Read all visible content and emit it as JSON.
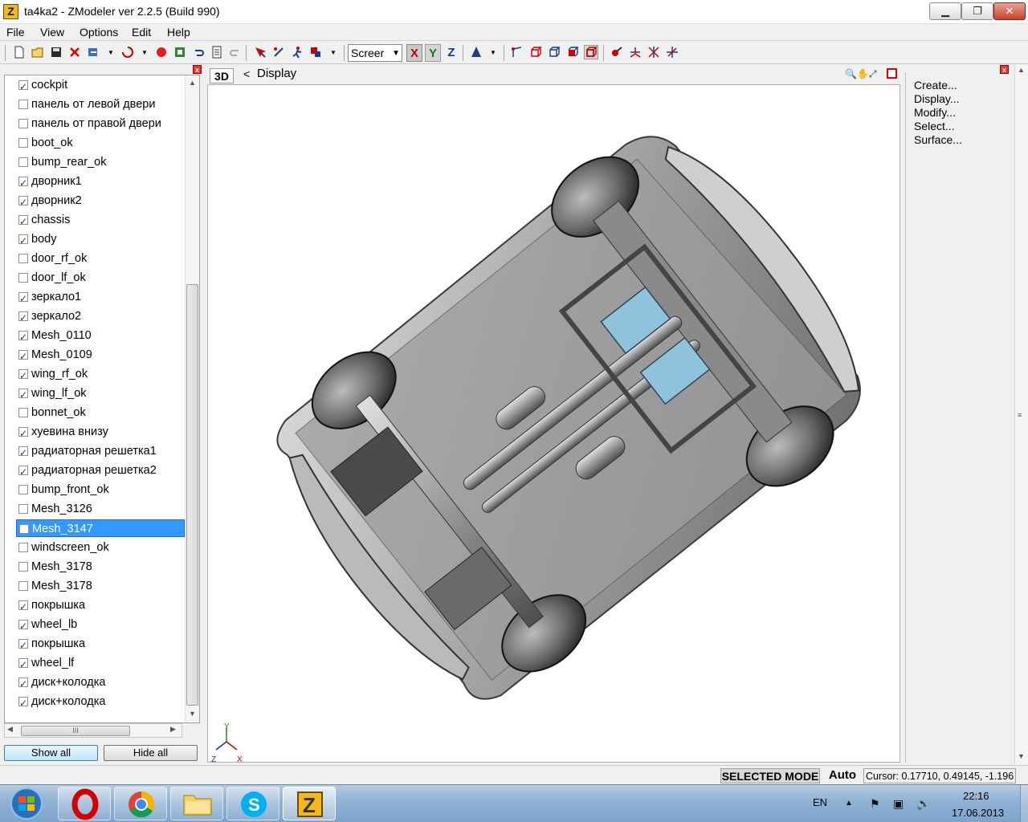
{
  "window": {
    "title": "ta4ka2 - ZModeler ver 2.2.5 (Build 990)",
    "app_icon_letter": "Z",
    "min_glyph": "▁",
    "max_glyph": "❐",
    "close_glyph": "✕"
  },
  "menu": [
    "File",
    "View",
    "Options",
    "Edit",
    "Help"
  ],
  "toolbar": {
    "view_select": "Screer",
    "axis": [
      "X",
      "Y",
      "Z"
    ]
  },
  "left_panel": {
    "close_glyph": "x",
    "objects": [
      {
        "name": "cockpit",
        "checked": true
      },
      {
        "name": "панель от левой двери",
        "checked": false
      },
      {
        "name": "панель от правой двери",
        "checked": false
      },
      {
        "name": "boot_ok",
        "checked": false
      },
      {
        "name": "bump_rear_ok",
        "checked": false
      },
      {
        "name": "дворник1",
        "checked": true
      },
      {
        "name": "дворник2",
        "checked": true
      },
      {
        "name": "chassis",
        "checked": true
      },
      {
        "name": "body",
        "checked": true
      },
      {
        "name": "door_rf_ok",
        "checked": false
      },
      {
        "name": "door_lf_ok",
        "checked": false
      },
      {
        "name": "зеркало1",
        "checked": true
      },
      {
        "name": "зеркало2",
        "checked": true
      },
      {
        "name": "Mesh_0110",
        "checked": true
      },
      {
        "name": "Mesh_0109",
        "checked": true
      },
      {
        "name": "wing_rf_ok",
        "checked": true
      },
      {
        "name": "wing_lf_ok",
        "checked": true
      },
      {
        "name": "bonnet_ok",
        "checked": false
      },
      {
        "name": "хуевина внизу",
        "checked": true
      },
      {
        "name": "радиаторная решетка1",
        "checked": true
      },
      {
        "name": "радиаторная решетка2",
        "checked": true
      },
      {
        "name": "bump_front_ok",
        "checked": false
      },
      {
        "name": "Mesh_3126",
        "checked": false
      },
      {
        "name": "Mesh_3147",
        "checked": false,
        "selected": true
      },
      {
        "name": "windscreen_ok",
        "checked": false
      },
      {
        "name": "Mesh_3178",
        "checked": false
      },
      {
        "name": "Mesh_3178",
        "checked": false
      },
      {
        "name": "покрышка",
        "checked": true
      },
      {
        "name": "wheel_lb",
        "checked": true
      },
      {
        "name": "покрышка",
        "checked": true
      },
      {
        "name": "wheel_lf",
        "checked": true
      },
      {
        "name": "диск+колодка",
        "checked": true
      },
      {
        "name": "диск+колодка",
        "checked": true
      }
    ],
    "hscroll_grip": "III",
    "show_all": "Show all",
    "hide_all": "Hide all"
  },
  "viewport": {
    "mode_label": "3D",
    "caret": "<",
    "title": "Display",
    "tool_glyphs": "🔍✋⤢",
    "gizmo_y": "Y",
    "gizmo_z": "Z",
    "gizmo_x": "X"
  },
  "right_panel": {
    "items": [
      "Create...",
      "Display...",
      "Modify...",
      "Select...",
      "Surface..."
    ]
  },
  "status": {
    "mode": "SELECTED MODE",
    "auto": "Auto",
    "cursor": "Cursor: 0.17710, 0.49145, -1.196"
  },
  "taskbar": {
    "lang": "EN",
    "time": "22:16",
    "date": "17.06.2013",
    "tasks": [
      "opera-icon",
      "chrome-icon",
      "explorer-icon",
      "skype-icon",
      "zmodeler-icon"
    ]
  },
  "colors": {
    "selection": "#3399ff",
    "car_body": "#a9a9a9",
    "car_accent": "#8fc3dc",
    "close_red": "#e00000"
  }
}
